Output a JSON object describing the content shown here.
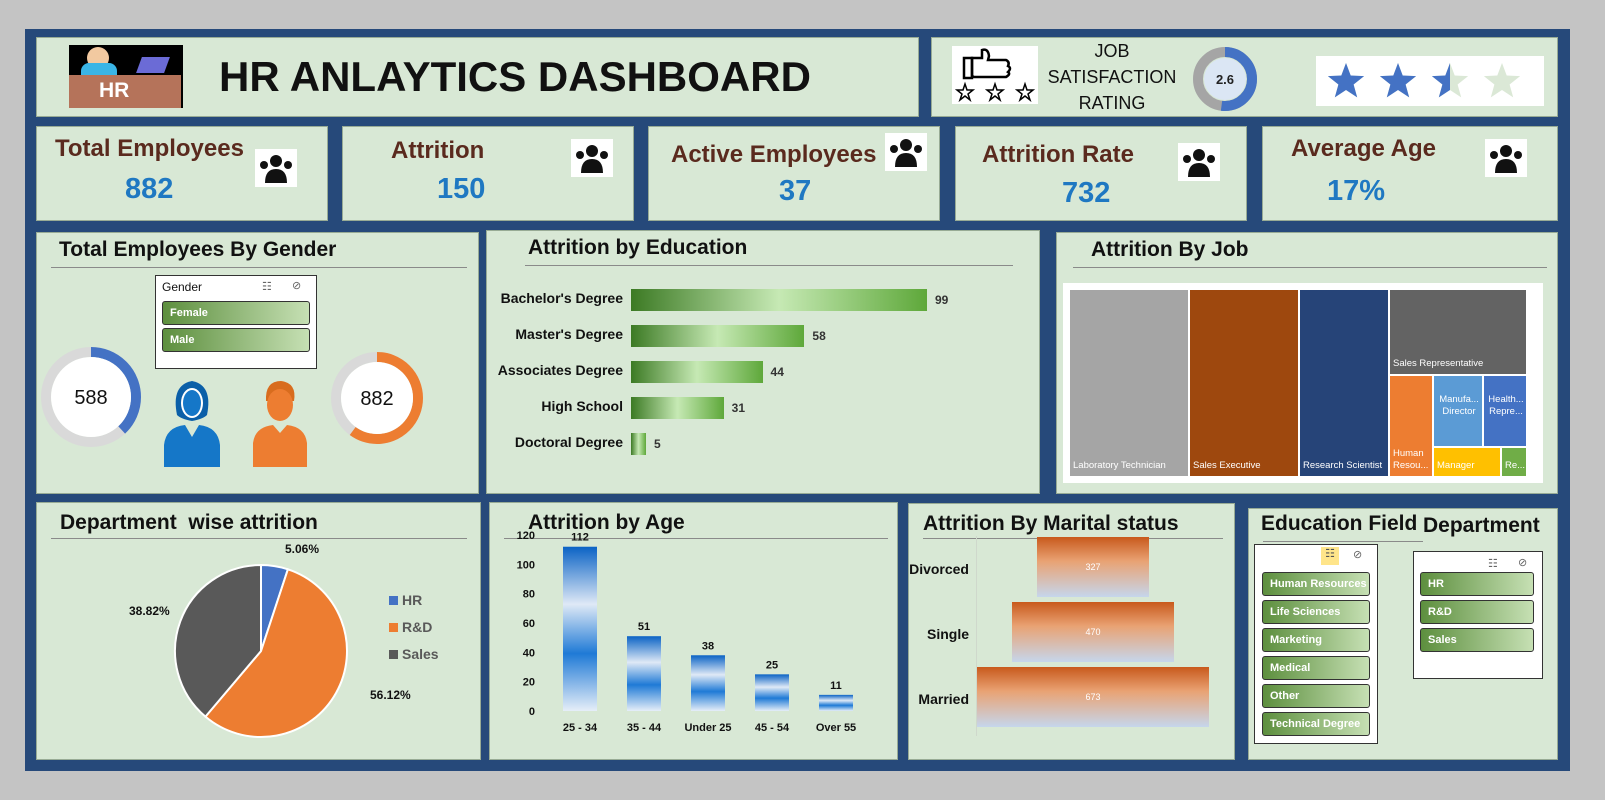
{
  "header": {
    "title": "HR ANLAYTICS DASHBOARD",
    "logo_text": "HR"
  },
  "satisfaction": {
    "label_line1": "JOB",
    "label_line2": "SATISFACTION",
    "label_line3": "RATING",
    "value_text": "2.6",
    "value": 2.6,
    "max": 5,
    "stars_filled": 2.5,
    "stars_total": 4
  },
  "kpis": [
    {
      "label": "Total Employees",
      "value": "882",
      "icon": "people-group-icon"
    },
    {
      "label": "Attrition",
      "value": "150",
      "icon": "people-leaving-icon"
    },
    {
      "label": "Active Employees",
      "value": "37",
      "icon": "desk-worker-icon"
    },
    {
      "label": "Attrition Rate",
      "value": "732",
      "icon": "percent-person-icon"
    },
    {
      "label": "Average Age",
      "value": "17%",
      "icon": "age-cycle-icon"
    }
  ],
  "gender_panel": {
    "title": "Total Employees By Gender",
    "slicer_title": "Gender",
    "slicer_items": [
      "Female",
      "Male"
    ],
    "female_value": "588",
    "male_value": "882"
  },
  "education_panel": {
    "title": "Attrition by Education"
  },
  "job_panel": {
    "title": "Attrition By Job"
  },
  "department_panel": {
    "title": "Department  wise attrition"
  },
  "age_panel": {
    "title": "Attrition by Age"
  },
  "marital_panel": {
    "title": "Attrition By Marital status"
  },
  "edu_field_panel": {
    "title": "Education Field",
    "items": [
      "Human Resources",
      "Life Sciences",
      "Marketing",
      "Medical",
      "Other",
      "Technical Degree"
    ]
  },
  "department_slicer": {
    "title": "Department",
    "items": [
      "HR",
      "R&D",
      "Sales"
    ]
  },
  "colors": {
    "blue": "#4472c4",
    "orange": "#ed7d31",
    "gray": "#595959",
    "kpi_value": "#1f78c2"
  },
  "chart_data": [
    {
      "type": "pie",
      "id": "gender-female-donut",
      "values": [
        588
      ],
      "labels": [
        "588"
      ],
      "fill_fraction": 0.38
    },
    {
      "type": "pie",
      "id": "gender-male-donut",
      "values": [
        882
      ],
      "labels": [
        "882"
      ],
      "fill_fraction": 0.6
    },
    {
      "type": "bar",
      "id": "education",
      "orientation": "horizontal",
      "categories": [
        "Bachelor's Degree",
        "Master's Degree",
        "Associates Degree",
        "High School",
        "Doctoral Degree"
      ],
      "values": [
        99,
        58,
        44,
        31,
        5
      ]
    },
    {
      "type": "heatmap",
      "id": "job-treemap",
      "subtype": "treemap",
      "categories": [
        "Laboratory Technician",
        "Sales Executive",
        "Research Scientist",
        "Sales Representative",
        "Human Resou...",
        "Manufa... Director",
        "Health... Repre...",
        "Manager",
        "Re..."
      ],
      "colors": [
        "#a5a5a5",
        "#9e480e",
        "#264478",
        "#636363",
        "#ed7d31",
        "#5b9bd5",
        "#4472c4",
        "#ffc000",
        "#70ad47"
      ]
    },
    {
      "type": "pie",
      "id": "department",
      "categories": [
        "HR",
        "R&D",
        "Sales"
      ],
      "values": [
        5.06,
        56.12,
        38.82
      ],
      "labels": [
        "5.06%",
        "56.12%",
        "38.82%"
      ],
      "legend": "right"
    },
    {
      "type": "bar",
      "id": "age",
      "categories": [
        "25 - 34",
        "35 - 44",
        "Under 25",
        "45 - 54",
        "Over 55"
      ],
      "values": [
        112,
        51,
        38,
        25,
        11
      ],
      "ylim": [
        0,
        120
      ],
      "yticks": [
        0,
        20,
        40,
        60,
        80,
        100,
        120
      ]
    },
    {
      "type": "bar",
      "id": "marital",
      "orientation": "horizontal",
      "categories": [
        "Divorced",
        "Single",
        "Married"
      ],
      "values": [
        327,
        470,
        673
      ]
    }
  ]
}
